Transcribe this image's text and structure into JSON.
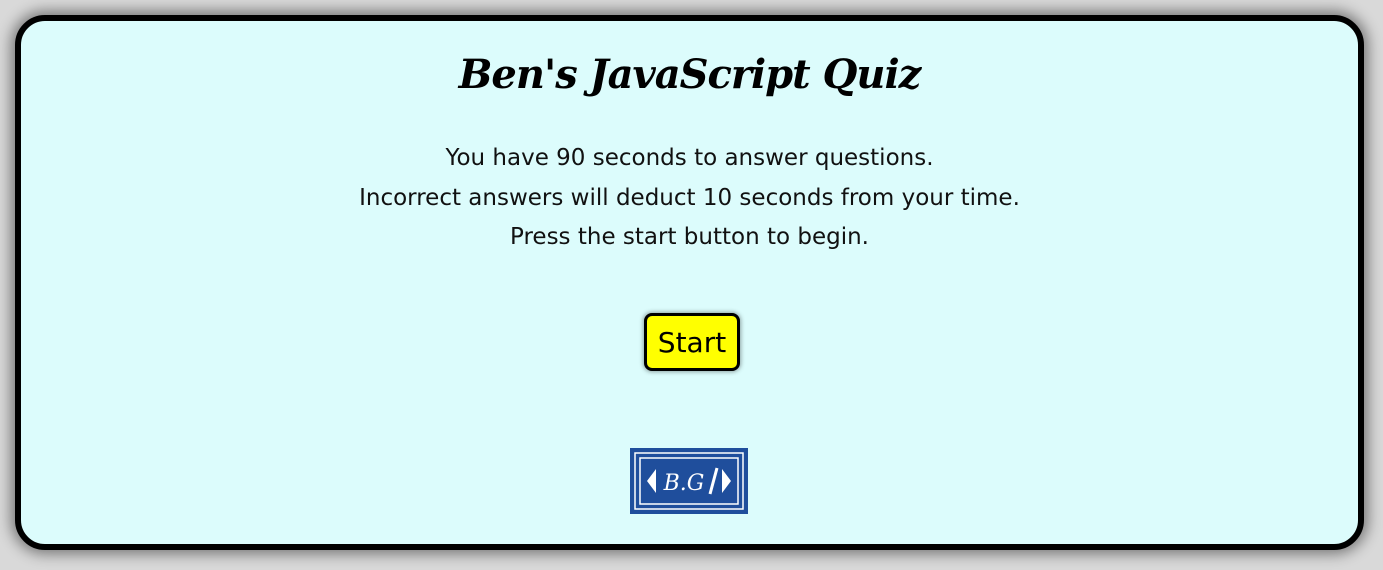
{
  "title": "Ben's JavaScript Quiz",
  "instructions": [
    "You have 90 seconds to answer questions.",
    "Incorrect answers will deduct 10 seconds from your time.",
    "Press the start button to begin."
  ],
  "start_button": {
    "label": "Start"
  },
  "logo": {
    "text": "<B.G/>",
    "icon": "bg-logo-icon"
  },
  "colors": {
    "background": "#dcfcfc",
    "button": "#ffff00",
    "logo": "#1f4e9c"
  }
}
